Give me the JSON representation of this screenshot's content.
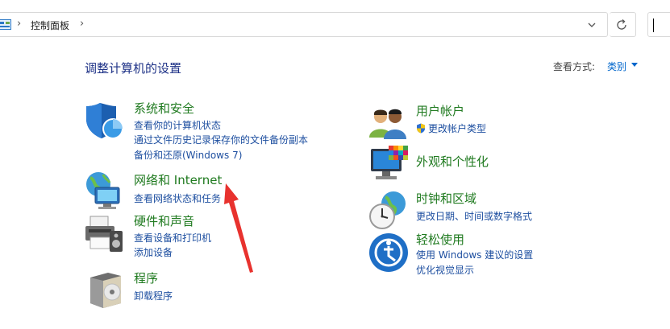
{
  "address_bar": {
    "breadcrumb": "控制面板",
    "dropdown_icon": "chevron-down-icon",
    "refresh_icon": "refresh-icon"
  },
  "header": {
    "title": "调整计算机的设置",
    "view_by_label": "查看方式:",
    "view_by_value": "类别"
  },
  "categories": [
    {
      "id": "system-security",
      "icon": "shield-icon",
      "title": "系统和安全",
      "links": [
        "查看你的计算机状态",
        "通过文件历史记录保存你的文件备份副本",
        "备份和还原(Windows 7)"
      ]
    },
    {
      "id": "network-internet",
      "icon": "globe-network-icon",
      "title": "网络和 Internet",
      "links": [
        "查看网络状态和任务"
      ]
    },
    {
      "id": "hardware-sound",
      "icon": "printer-speaker-icon",
      "title": "硬件和声音",
      "links": [
        "查看设备和打印机",
        "添加设备"
      ]
    },
    {
      "id": "programs",
      "icon": "programs-disc-icon",
      "title": "程序",
      "links": [
        "卸载程序"
      ]
    },
    {
      "id": "user-accounts",
      "icon": "users-icon",
      "title": "用户帐户",
      "links": [
        "更改帐户类型"
      ]
    },
    {
      "id": "appearance",
      "icon": "monitor-palette-icon",
      "title": "外观和个性化",
      "links": []
    },
    {
      "id": "clock-region",
      "icon": "clock-globe-icon",
      "title": "时钟和区域",
      "links": [
        "更改日期、时间或数字格式"
      ]
    },
    {
      "id": "ease-of-access",
      "icon": "ease-of-access-icon",
      "title": "轻松使用",
      "links": [
        "使用 Windows 建议的设置",
        "优化视觉显示"
      ]
    }
  ],
  "colors": {
    "title_green": "#1f7a1f",
    "link_blue": "#1e4fa0",
    "header_blue": "#1e3287",
    "annotation_red": "#e8322e"
  }
}
